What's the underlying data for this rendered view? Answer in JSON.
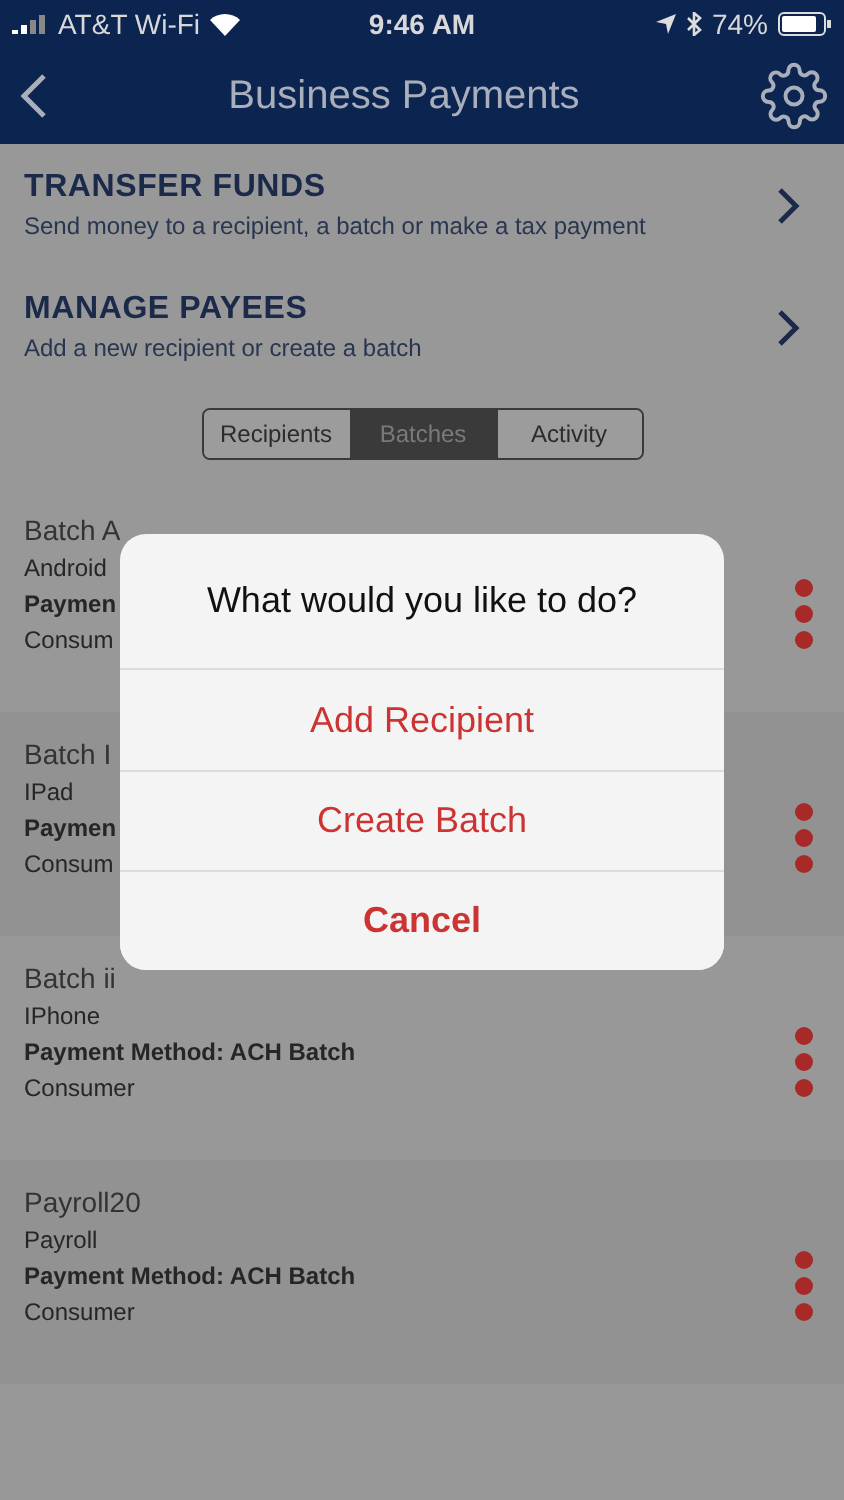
{
  "status_bar": {
    "carrier": "AT&T Wi-Fi",
    "time": "9:46 AM",
    "battery": "74%"
  },
  "nav": {
    "title": "Business Payments"
  },
  "menu": [
    {
      "title": "TRANSFER FUNDS",
      "subtitle": "Send money to a recipient, a batch or make a tax payment"
    },
    {
      "title": "MANAGE PAYEES",
      "subtitle": "Add a new recipient or create a batch"
    }
  ],
  "tabs": [
    {
      "label": "Recipients",
      "selected": false
    },
    {
      "label": "Batches",
      "selected": true
    },
    {
      "label": "Activity",
      "selected": false
    }
  ],
  "batches": [
    {
      "name": "Batch A",
      "device": "Android",
      "method": "Paymen",
      "type": "Consum"
    },
    {
      "name": "Batch I",
      "device": "IPad",
      "method": "Paymen",
      "type": "Consum"
    },
    {
      "name": "Batch ii",
      "device": "IPhone",
      "method": "Payment Method: ACH Batch",
      "type": "Consumer"
    },
    {
      "name": "Payroll20",
      "device": "Payroll",
      "method": "Payment Method: ACH Batch",
      "type": "Consumer"
    }
  ],
  "dialog": {
    "title": "What would you like to do?",
    "actions": [
      {
        "label": "Add Recipient",
        "kind": "default"
      },
      {
        "label": "Create Batch",
        "kind": "default"
      },
      {
        "label": "Cancel",
        "kind": "cancel"
      }
    ]
  }
}
